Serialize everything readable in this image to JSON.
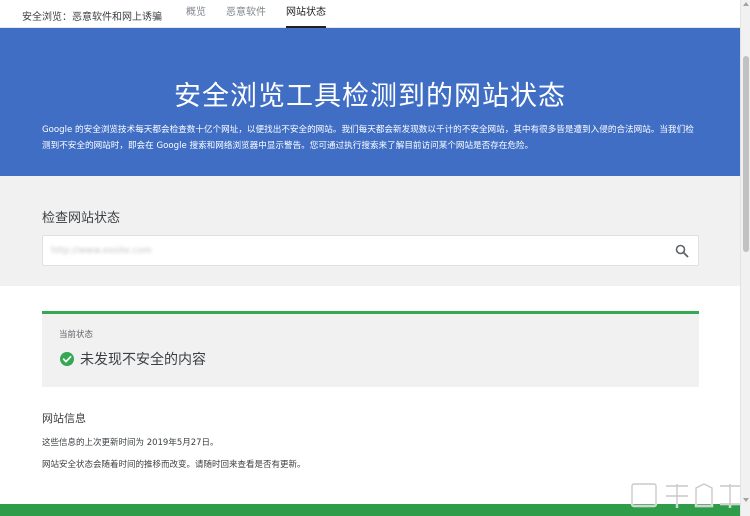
{
  "topnav": {
    "brand": "安全浏览：恶意软件和网上诱骗",
    "tabs": [
      {
        "label": "概览",
        "active": false
      },
      {
        "label": "恶意软件",
        "active": false
      },
      {
        "label": "网站状态",
        "active": true
      }
    ]
  },
  "hero": {
    "title": "安全浏览工具检测到的网站状态",
    "description": "Google 的安全浏览技术每天都会检查数十亿个网址，以便找出不安全的网站。我们每天都会新发现数以千计的不安全网站，其中有很多皆是遭到入侵的合法网站。当我们检测到不安全的网站时，即会在 Google 搜索和网络浏览器中显示警告。您可通过执行搜索来了解目前访问某个网站是否存在危险。"
  },
  "search": {
    "title": "检查网站状态",
    "value": "http://www.exsite.com",
    "icon": "search-icon"
  },
  "status": {
    "label": "当前状态",
    "text": "未发现不安全的内容",
    "icon": "check-circle-icon",
    "accent": "#34a853"
  },
  "site_info": {
    "title": "网站信息",
    "line1": "这些信息的上次更新时间为 2019年5月27日。",
    "line2": "网站安全状态会随着时间的推移而改变。请随时回来查看是否有更新。"
  },
  "colors": {
    "hero_bg": "#3f6ec4",
    "bottom_bar": "#2e9c48"
  }
}
